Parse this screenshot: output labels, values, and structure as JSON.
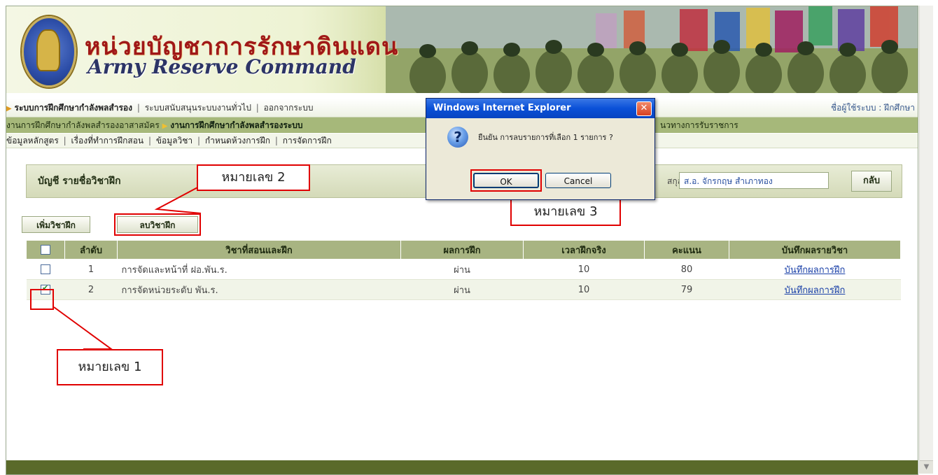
{
  "header": {
    "title_th": "หน่วยบัญชาการรักษาดินแดน",
    "title_en": "Army Reserve Command"
  },
  "nav1": {
    "items": [
      "ระบบการฝึกศึกษากำลังพลสำรอง",
      "ระบบสนับสนุนระบบงานทั่วไป",
      "ออกจากระบบ"
    ],
    "user_label": "ชื่อผู้ใช้ระบบ : ฝึกศึกษา"
  },
  "nav2": {
    "item1": "งานการฝึกศึกษากำลังพลสำรองอาสาสมัคร",
    "item2": "งานการฝึกศึกษากำลังพลสำรองระบบ",
    "item3": "นวทางการรับราชการ"
  },
  "nav3": {
    "items": [
      "ข้อมูลหลักสูตร",
      "เรื่องที่ทำการฝึกสอน",
      "ข้อมูลวิชา",
      "กำหนดห้วงการฝึก",
      "การจัดการฝึก"
    ]
  },
  "panel": {
    "title": "บัญชี รายชื่อวิชาฝึก",
    "rank_label": "สกุล :",
    "name": "ส.อ. จักรกฤษ  สำเภาทอง",
    "back": "กลับ"
  },
  "actions": {
    "add": "เพิ่มวิชาฝึก",
    "delete": "ลบวิชาฝึก"
  },
  "table": {
    "headers": [
      "ลำดับ",
      "วิชาที่สอนและฝึก",
      "ผลการฝึก",
      "เวลาฝึกจริง",
      "คะแนน",
      "บันทึกผลรายวิชา"
    ],
    "rows": [
      {
        "no": "1",
        "subject": "การจัดและหน้าที่ ฝอ.พัน.ร.",
        "result": "ผ่าน",
        "hours": "10",
        "score": "80",
        "link": "บันทึกผลการฝึก",
        "checked": false
      },
      {
        "no": "2",
        "subject": "การจัดหน่วยระดับ พัน.ร.",
        "result": "ผ่าน",
        "hours": "10",
        "score": "79",
        "link": "บันทึกผลการฝึก",
        "checked": true
      }
    ]
  },
  "dialog": {
    "title": "Windows Internet Explorer",
    "message": "ยืนยัน การลบรายการที่เลือก 1 รายการ ?",
    "ok": "OK",
    "cancel": "Cancel"
  },
  "callouts": {
    "one": "หมายเลข 1",
    "two": "หมายเลข 2",
    "three": "หมายเลข 3"
  },
  "colors": {
    "accent_red": "#e00000",
    "nav_green": "#a6b87a",
    "header_green": "#a8b482"
  }
}
